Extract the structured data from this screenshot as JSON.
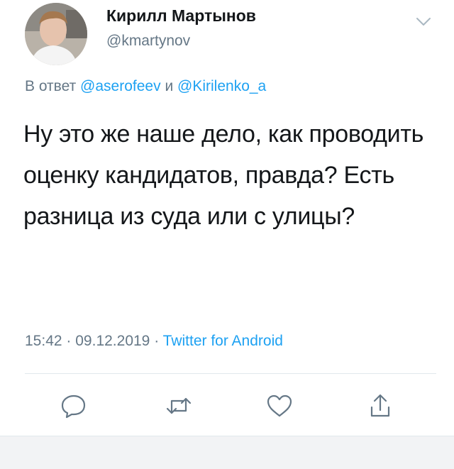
{
  "author": {
    "display_name": "Кирилл Мартынов",
    "handle": "@kmartynov"
  },
  "reply": {
    "prefix": "В ответ",
    "mention_1": "@aserofeev",
    "conjunction": "и",
    "mention_2": "@Kirilenko_a"
  },
  "tweet": {
    "text": "Ну это же наше дело, как проводить оценку кандидатов, правда? Есть разница из суда или с улицы?"
  },
  "meta": {
    "time": "15:42",
    "separator": "·",
    "date": "09.12.2019",
    "source": "Twitter for Android"
  },
  "icons": {
    "menu": "chevron-down-icon",
    "reply": "reply-icon",
    "retweet": "retweet-icon",
    "like": "heart-icon",
    "share": "share-icon"
  },
  "colors": {
    "text": "#14171a",
    "secondary": "#657786",
    "accent": "#1da1f2",
    "divider": "#e1e8ed"
  }
}
